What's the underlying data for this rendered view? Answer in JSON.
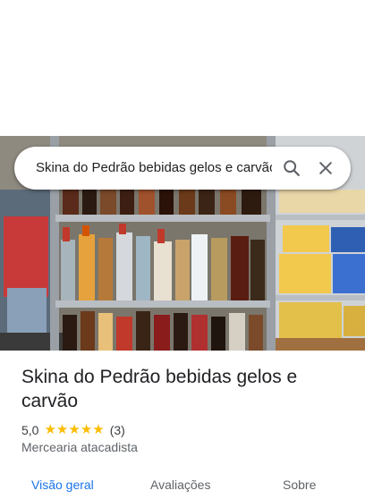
{
  "search": {
    "query": "Skina do Pedrão bebidas gelos e carvão"
  },
  "place": {
    "name": "Skina do Pedrão bebidas gelos e carvão",
    "rating": "5,0",
    "stars": [
      "★",
      "★",
      "★",
      "★",
      "★"
    ],
    "review_count": "(3)",
    "category": "Mercearia atacadista"
  },
  "tabs": [
    {
      "label": "Visão geral"
    },
    {
      "label": "Avaliações"
    },
    {
      "label": "Sobre"
    }
  ],
  "colors": {
    "accent": "#1a73e8",
    "star": "#fbbc04"
  }
}
